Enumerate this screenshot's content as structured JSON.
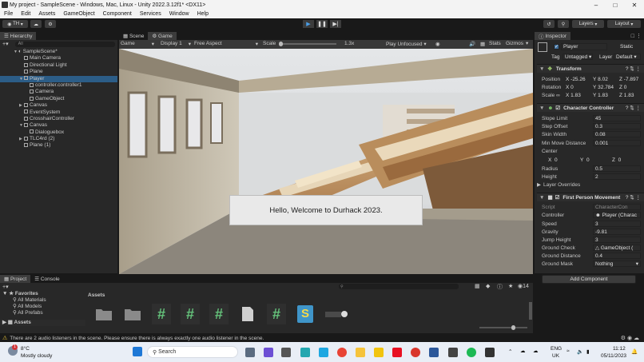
{
  "window": {
    "title": "My project - SampleScene - Windows, Mac, Linux - Unity 2022.3.12f1* <DX11>"
  },
  "menu": [
    "File",
    "Edit",
    "Assets",
    "GameObject",
    "Component",
    "Services",
    "Window",
    "Help"
  ],
  "toolbar": {
    "account": "TH",
    "layers": "Layers",
    "layout": "Layout"
  },
  "hierarchy": {
    "tab": "Hierarchy",
    "search_placeholder": "All",
    "items": [
      "SampleScene*",
      "Main Camera",
      "Directional Light",
      "Plane",
      "Player",
      "controller.controller1",
      "Camera",
      "GameObject",
      "Canvas",
      "EventSystem",
      "CrosshairController",
      "Canvas",
      "Dialoguebox",
      "TLC4rd (2)",
      "Plane (1)"
    ]
  },
  "sceneview": {
    "tabs": [
      "Scene",
      "Game"
    ],
    "mode": "Game",
    "display": "Display 1",
    "aspect": "Free Aspect",
    "scale_label": "Scale",
    "scale_value": "1.3x",
    "play_focus": "Play Unfocused",
    "stats": "Stats",
    "gizmos": "Gizmos",
    "dialogue_text": "Hello, Welcome to Durhack 2023."
  },
  "inspector": {
    "tab": "Inspector",
    "object_name": "Player",
    "static_label": "Static",
    "tag_label": "Tag",
    "tag_value": "Untagged",
    "layer_label": "Layer",
    "layer_value": "Default",
    "transform": {
      "title": "Transform",
      "position_label": "Position",
      "position": {
        "x": "-25.26",
        "y": "8.02",
        "z": "-7.897"
      },
      "rotation_label": "Rotation",
      "rotation": {
        "x": "0",
        "y": "32.784",
        "z": "0"
      },
      "scale_label": "Scale",
      "scale": {
        "x": "1.83",
        "y": "1.83",
        "z": "1.83"
      }
    },
    "character_controller": {
      "title": "Character Controller",
      "fields": [
        {
          "label": "Slope Limit",
          "value": "45"
        },
        {
          "label": "Step Offset",
          "value": "0.3"
        },
        {
          "label": "Skin Width",
          "value": "0.08"
        },
        {
          "label": "Min Move Distance",
          "value": "0.001"
        }
      ],
      "center_label": "Center",
      "center": {
        "x": "0",
        "y": "0",
        "z": "0"
      },
      "radius_label": "Radius",
      "radius": "0.5",
      "height_label": "Height",
      "height": "2",
      "layer_overrides": "Layer Overrides"
    },
    "fpm": {
      "title": "First Person Movement",
      "fields": [
        {
          "label": "Script",
          "value": "CharacterCon"
        },
        {
          "label": "Controller",
          "value": "Player (Charac"
        },
        {
          "label": "Speed",
          "value": "3"
        },
        {
          "label": "Gravity",
          "value": "-9.81"
        },
        {
          "label": "Jump Height",
          "value": "3"
        },
        {
          "label": "Ground Check",
          "value": "GameObject ("
        },
        {
          "label": "Ground Distance",
          "value": "0.4"
        },
        {
          "label": "Ground Mask",
          "value": "Nothing"
        }
      ]
    },
    "add_component": "Add Component"
  },
  "project": {
    "tabs": [
      "Project",
      "Console"
    ],
    "favorites": "Favorites",
    "fav_items": [
      "All Materials",
      "All Models",
      "All Prefabs"
    ],
    "assets_root": "Assets",
    "assets_header": "Assets",
    "count": "14"
  },
  "statusbar": {
    "message": "There are 2 audio listeners in the scene. Please ensure there is always exactly one audio listener in the scene."
  },
  "taskbar": {
    "temp": "8°C",
    "weather": "Mostly cloudy",
    "search": "Search",
    "lang1": "ENG",
    "lang2": "UK",
    "time": "11:12",
    "date": "05/11/2023",
    "badge": "1"
  }
}
